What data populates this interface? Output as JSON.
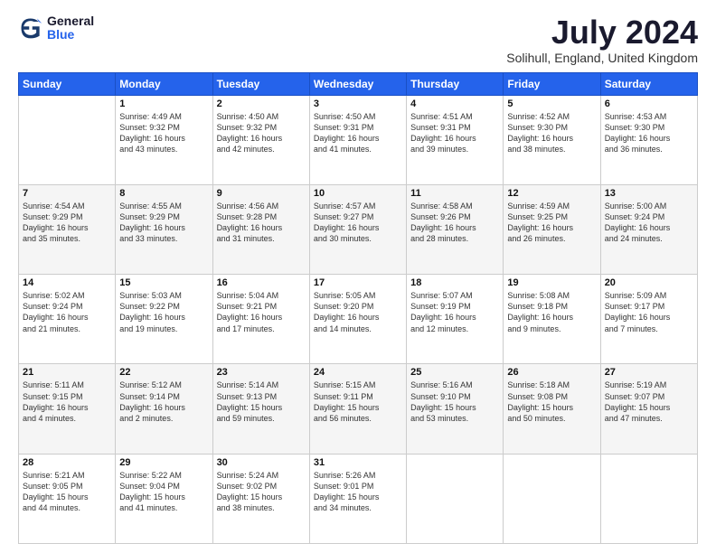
{
  "header": {
    "logo_general": "General",
    "logo_blue": "Blue",
    "month": "July 2024",
    "location": "Solihull, England, United Kingdom"
  },
  "days_of_week": [
    "Sunday",
    "Monday",
    "Tuesday",
    "Wednesday",
    "Thursday",
    "Friday",
    "Saturday"
  ],
  "weeks": [
    [
      {
        "day": "",
        "content": ""
      },
      {
        "day": "1",
        "content": "Sunrise: 4:49 AM\nSunset: 9:32 PM\nDaylight: 16 hours\nand 43 minutes."
      },
      {
        "day": "2",
        "content": "Sunrise: 4:50 AM\nSunset: 9:32 PM\nDaylight: 16 hours\nand 42 minutes."
      },
      {
        "day": "3",
        "content": "Sunrise: 4:50 AM\nSunset: 9:31 PM\nDaylight: 16 hours\nand 41 minutes."
      },
      {
        "day": "4",
        "content": "Sunrise: 4:51 AM\nSunset: 9:31 PM\nDaylight: 16 hours\nand 39 minutes."
      },
      {
        "day": "5",
        "content": "Sunrise: 4:52 AM\nSunset: 9:30 PM\nDaylight: 16 hours\nand 38 minutes."
      },
      {
        "day": "6",
        "content": "Sunrise: 4:53 AM\nSunset: 9:30 PM\nDaylight: 16 hours\nand 36 minutes."
      }
    ],
    [
      {
        "day": "7",
        "content": "Sunrise: 4:54 AM\nSunset: 9:29 PM\nDaylight: 16 hours\nand 35 minutes."
      },
      {
        "day": "8",
        "content": "Sunrise: 4:55 AM\nSunset: 9:29 PM\nDaylight: 16 hours\nand 33 minutes."
      },
      {
        "day": "9",
        "content": "Sunrise: 4:56 AM\nSunset: 9:28 PM\nDaylight: 16 hours\nand 31 minutes."
      },
      {
        "day": "10",
        "content": "Sunrise: 4:57 AM\nSunset: 9:27 PM\nDaylight: 16 hours\nand 30 minutes."
      },
      {
        "day": "11",
        "content": "Sunrise: 4:58 AM\nSunset: 9:26 PM\nDaylight: 16 hours\nand 28 minutes."
      },
      {
        "day": "12",
        "content": "Sunrise: 4:59 AM\nSunset: 9:25 PM\nDaylight: 16 hours\nand 26 minutes."
      },
      {
        "day": "13",
        "content": "Sunrise: 5:00 AM\nSunset: 9:24 PM\nDaylight: 16 hours\nand 24 minutes."
      }
    ],
    [
      {
        "day": "14",
        "content": "Sunrise: 5:02 AM\nSunset: 9:24 PM\nDaylight: 16 hours\nand 21 minutes."
      },
      {
        "day": "15",
        "content": "Sunrise: 5:03 AM\nSunset: 9:22 PM\nDaylight: 16 hours\nand 19 minutes."
      },
      {
        "day": "16",
        "content": "Sunrise: 5:04 AM\nSunset: 9:21 PM\nDaylight: 16 hours\nand 17 minutes."
      },
      {
        "day": "17",
        "content": "Sunrise: 5:05 AM\nSunset: 9:20 PM\nDaylight: 16 hours\nand 14 minutes."
      },
      {
        "day": "18",
        "content": "Sunrise: 5:07 AM\nSunset: 9:19 PM\nDaylight: 16 hours\nand 12 minutes."
      },
      {
        "day": "19",
        "content": "Sunrise: 5:08 AM\nSunset: 9:18 PM\nDaylight: 16 hours\nand 9 minutes."
      },
      {
        "day": "20",
        "content": "Sunrise: 5:09 AM\nSunset: 9:17 PM\nDaylight: 16 hours\nand 7 minutes."
      }
    ],
    [
      {
        "day": "21",
        "content": "Sunrise: 5:11 AM\nSunset: 9:15 PM\nDaylight: 16 hours\nand 4 minutes."
      },
      {
        "day": "22",
        "content": "Sunrise: 5:12 AM\nSunset: 9:14 PM\nDaylight: 16 hours\nand 2 minutes."
      },
      {
        "day": "23",
        "content": "Sunrise: 5:14 AM\nSunset: 9:13 PM\nDaylight: 15 hours\nand 59 minutes."
      },
      {
        "day": "24",
        "content": "Sunrise: 5:15 AM\nSunset: 9:11 PM\nDaylight: 15 hours\nand 56 minutes."
      },
      {
        "day": "25",
        "content": "Sunrise: 5:16 AM\nSunset: 9:10 PM\nDaylight: 15 hours\nand 53 minutes."
      },
      {
        "day": "26",
        "content": "Sunrise: 5:18 AM\nSunset: 9:08 PM\nDaylight: 15 hours\nand 50 minutes."
      },
      {
        "day": "27",
        "content": "Sunrise: 5:19 AM\nSunset: 9:07 PM\nDaylight: 15 hours\nand 47 minutes."
      }
    ],
    [
      {
        "day": "28",
        "content": "Sunrise: 5:21 AM\nSunset: 9:05 PM\nDaylight: 15 hours\nand 44 minutes."
      },
      {
        "day": "29",
        "content": "Sunrise: 5:22 AM\nSunset: 9:04 PM\nDaylight: 15 hours\nand 41 minutes."
      },
      {
        "day": "30",
        "content": "Sunrise: 5:24 AM\nSunset: 9:02 PM\nDaylight: 15 hours\nand 38 minutes."
      },
      {
        "day": "31",
        "content": "Sunrise: 5:26 AM\nSunset: 9:01 PM\nDaylight: 15 hours\nand 34 minutes."
      },
      {
        "day": "",
        "content": ""
      },
      {
        "day": "",
        "content": ""
      },
      {
        "day": "",
        "content": ""
      }
    ]
  ]
}
